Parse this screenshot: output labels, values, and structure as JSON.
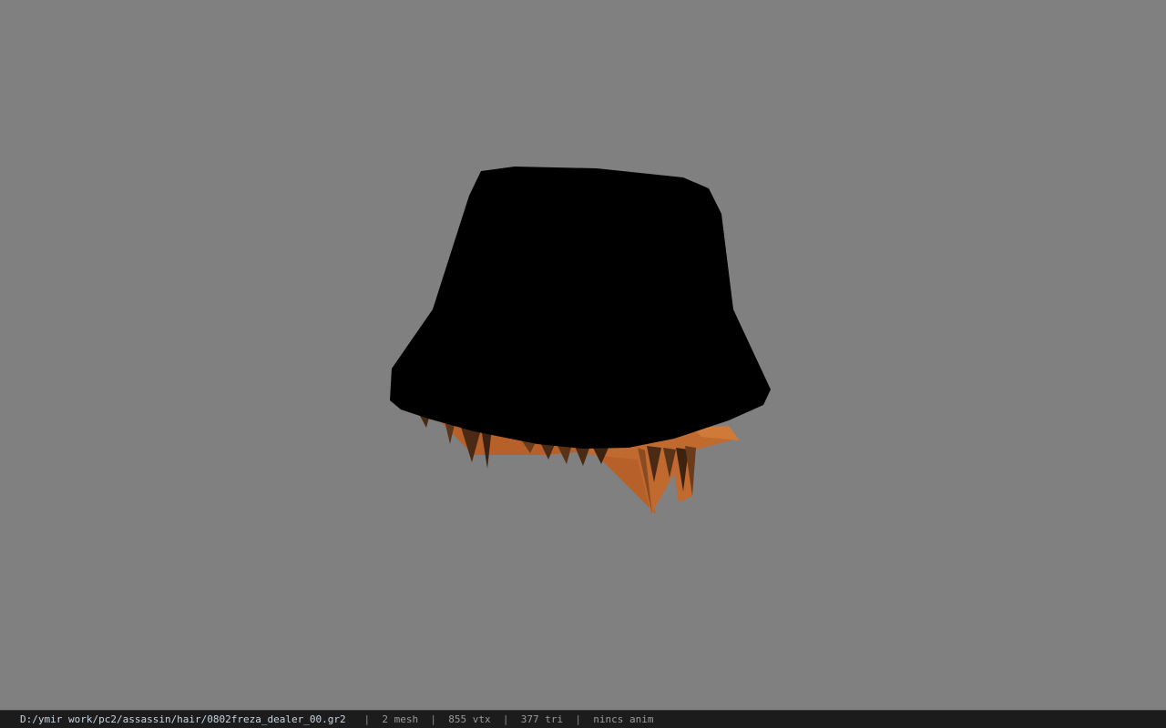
{
  "viewport": {
    "background": "#808080",
    "model": {
      "hat_color": "#000000",
      "hair_color": "#b8602a",
      "hair_shadow_color": "#4a2a14"
    }
  },
  "statusbar": {
    "file_path": "D:/ymir work/pc2/assassin/hair/0802freza_dealer_00.gr2",
    "separator": "|",
    "mesh": "2 mesh",
    "vtx": "855 vtx",
    "tri": "377 tri",
    "anim": "nincs anim"
  }
}
